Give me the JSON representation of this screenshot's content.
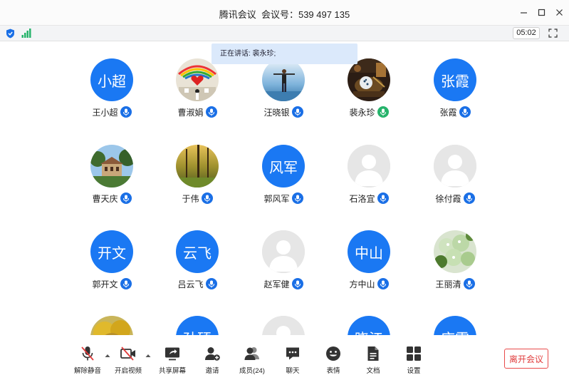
{
  "window": {
    "title": "腾讯会议  会议号：539 497 135"
  },
  "status": {
    "timer": "05:02"
  },
  "speaking": {
    "text": "正在讲话: 裴永珍;"
  },
  "participants": [
    {
      "name": "王小超",
      "avatar_type": "text",
      "avatar_text": "小超",
      "mic": "on"
    },
    {
      "name": "曹淑娟",
      "avatar_type": "photo",
      "photo": "hearts-board",
      "mic": "on"
    },
    {
      "name": "汪晓银",
      "avatar_type": "photo",
      "photo": "person-sky",
      "mic": "on"
    },
    {
      "name": "裴永珍",
      "avatar_type": "photo",
      "photo": "still-life",
      "mic": "speaking"
    },
    {
      "name": "张霞",
      "avatar_type": "text",
      "avatar_text": "张霞",
      "mic": "on"
    },
    {
      "name": "曹天庆",
      "avatar_type": "photo",
      "photo": "building-trees",
      "mic": "on"
    },
    {
      "name": "于伟",
      "avatar_type": "photo",
      "photo": "autumn-forest",
      "mic": "on"
    },
    {
      "name": "郭风军",
      "avatar_type": "text",
      "avatar_text": "风军",
      "mic": "on"
    },
    {
      "name": "石洛宜",
      "avatar_type": "default",
      "mic": "on"
    },
    {
      "name": "徐付霞",
      "avatar_type": "default",
      "mic": "on"
    },
    {
      "name": "郭开文",
      "avatar_type": "text",
      "avatar_text": "开文",
      "mic": "on"
    },
    {
      "name": "吕云飞",
      "avatar_type": "text",
      "avatar_text": "云飞",
      "mic": "on"
    },
    {
      "name": "赵军健",
      "avatar_type": "default",
      "mic": "on"
    },
    {
      "name": "方中山",
      "avatar_type": "text",
      "avatar_text": "中山",
      "mic": "on"
    },
    {
      "name": "王丽清",
      "avatar_type": "photo",
      "photo": "green-flowers",
      "mic": "on"
    },
    {
      "name": "",
      "avatar_type": "photo",
      "photo": "yellow-tree",
      "mic": "none"
    },
    {
      "name": "",
      "avatar_type": "text",
      "avatar_text": "孙硕",
      "mic": "none"
    },
    {
      "name": "",
      "avatar_type": "default",
      "mic": "none"
    },
    {
      "name": "",
      "avatar_type": "text",
      "avatar_text": "晓江",
      "mic": "none"
    },
    {
      "name": "",
      "avatar_type": "text",
      "avatar_text": "庆霞",
      "mic": "none"
    }
  ],
  "toolbar": {
    "unmute": "解除静音",
    "start_video": "开启视频",
    "share_screen": "共享屏幕",
    "invite": "邀请",
    "members": "成员(24)",
    "chat": "聊天",
    "reactions": "表情",
    "docs": "文档",
    "settings": "设置",
    "leave": "离开会议"
  },
  "colors": {
    "accent": "#1a78f3",
    "speaking_mic": "#26b36b",
    "muted_red": "#e03c3c",
    "banner_bg": "#dbe9fb"
  },
  "icons": {
    "mic": "mic-icon",
    "muted_mic": "mic-off-icon",
    "video_off": "video-off-icon",
    "share": "share-screen-icon",
    "invite": "add-user-icon",
    "members": "users-icon",
    "chat": "chat-icon",
    "reactions": "smile-icon",
    "docs": "document-icon",
    "settings": "grid-icon"
  }
}
